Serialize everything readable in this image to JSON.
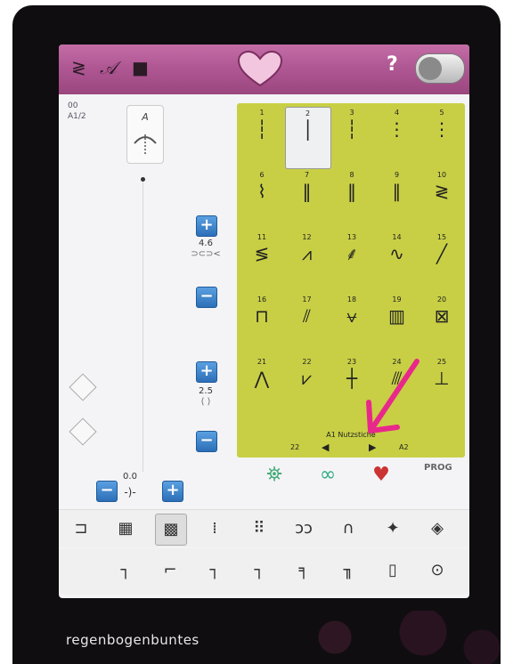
{
  "watermark": "regenbogenbuntes",
  "topbar": {
    "icons": [
      "stitch-menu-icon",
      "font-icon",
      "folder-icon"
    ],
    "heart_icon": "heart-icon",
    "help_label": "?",
    "toggle_icon": "toggle-icon"
  },
  "left": {
    "pos_top": "00",
    "pos_bottom": "A1/2",
    "presser_label": "A",
    "width_value": "4.6",
    "width_symbol": "⊃⊂⊃<",
    "length_value": "2.5",
    "length_symbol": "⟨ ⟩",
    "balance_value": "0.0",
    "balance_symbol": "-)-"
  },
  "grid": {
    "cells": [
      {
        "n": "1",
        "g": "┆"
      },
      {
        "n": "2",
        "g": "│"
      },
      {
        "n": "3",
        "g": "┆"
      },
      {
        "n": "4",
        "g": "⋮"
      },
      {
        "n": "5",
        "g": "⋮"
      },
      {
        "n": "6",
        "g": "⌇"
      },
      {
        "n": "7",
        "g": "‖"
      },
      {
        "n": "8",
        "g": "‖"
      },
      {
        "n": "9",
        "g": "∥"
      },
      {
        "n": "10",
        "g": "≷"
      },
      {
        "n": "11",
        "g": "≶"
      },
      {
        "n": "12",
        "g": "⩘"
      },
      {
        "n": "13",
        "g": "⸙"
      },
      {
        "n": "14",
        "g": "∿"
      },
      {
        "n": "15",
        "g": "╱"
      },
      {
        "n": "16",
        "g": "⊓"
      },
      {
        "n": "17",
        "g": "⫽"
      },
      {
        "n": "18",
        "g": "⩝"
      },
      {
        "n": "19",
        "g": "▥"
      },
      {
        "n": "20",
        "g": "⊠"
      },
      {
        "n": "21",
        "g": "⋀"
      },
      {
        "n": "22",
        "g": "⩗"
      },
      {
        "n": "23",
        "g": "┼"
      },
      {
        "n": "24",
        "g": "⫻"
      },
      {
        "n": "25",
        "g": "⊥"
      }
    ],
    "category": "A1 Nutzstiche",
    "prev_page": "22",
    "next_page": "A2"
  },
  "bottom": {
    "row1": [
      "⊐",
      "▦",
      "▩",
      "⁞",
      "⠿",
      "ↄↄ",
      "∩",
      "✦",
      "◈"
    ],
    "row2": [
      "┐",
      "⌐",
      "┐",
      "┐",
      "╕",
      "╖",
      "▯",
      "⊙"
    ]
  }
}
